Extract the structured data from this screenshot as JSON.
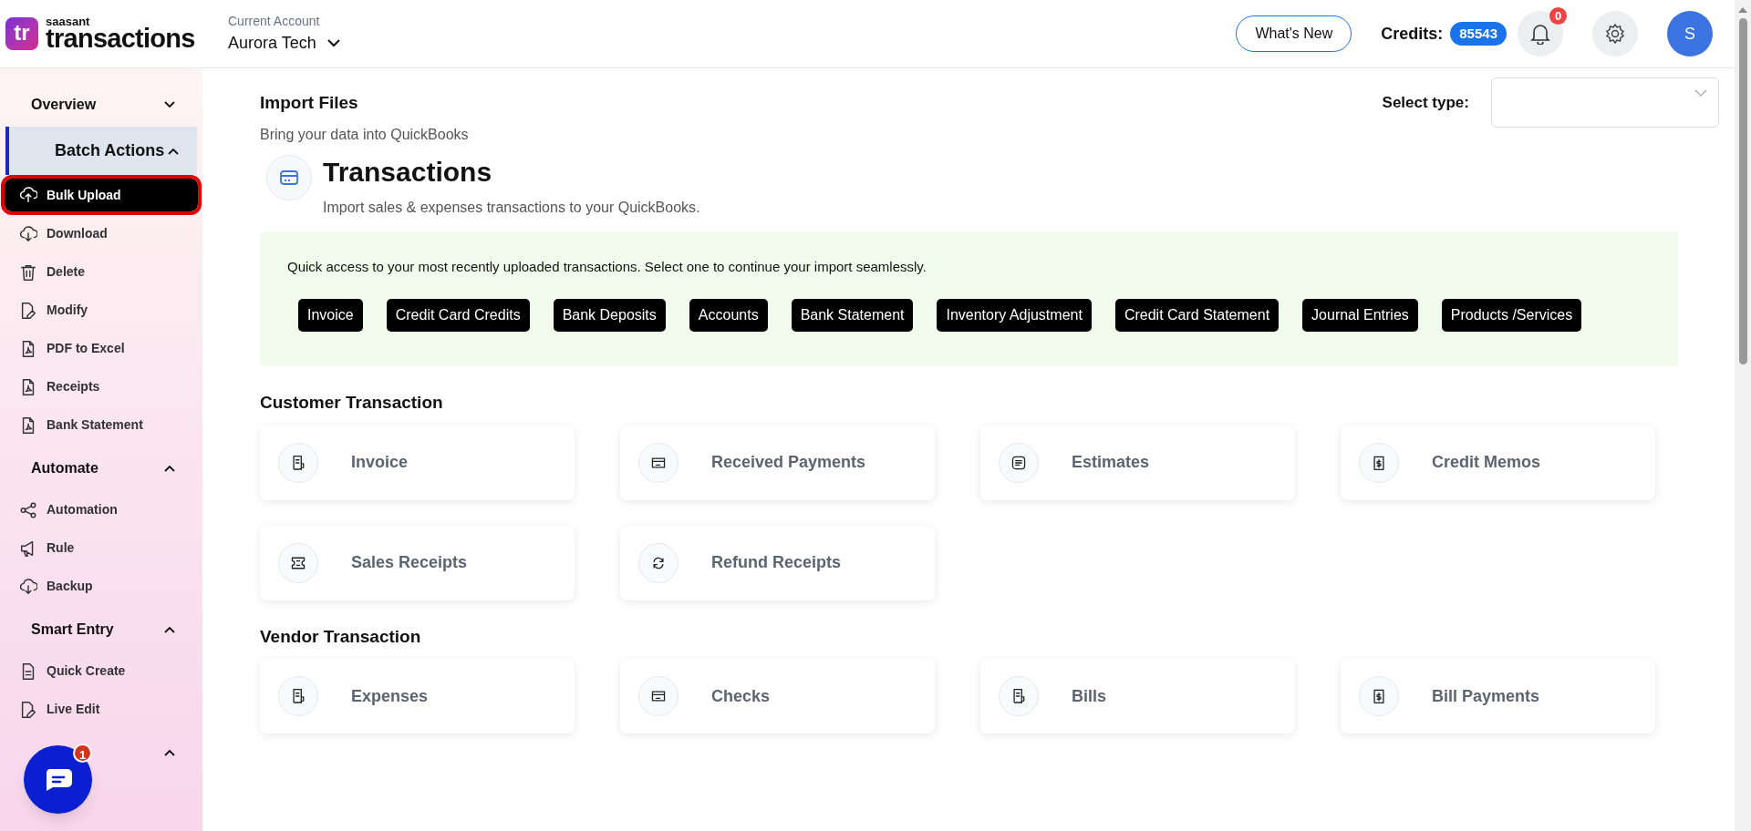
{
  "brand": {
    "logo": "tr",
    "small": "saasant",
    "large": "transactions"
  },
  "account": {
    "label": "Current Account",
    "name": "Aurora Tech"
  },
  "header": {
    "whats_new": "What's New",
    "credits_label": "Credits:",
    "credits": "85543",
    "notifications": "0",
    "avatar": "S"
  },
  "sidebar": {
    "sections": [
      {
        "title": "Overview",
        "expanded": false,
        "selected": false
      },
      {
        "title": "Batch Actions",
        "expanded": true,
        "selected": true,
        "items": [
          {
            "label": "Bulk Upload",
            "kind": "upload",
            "selected": true
          },
          {
            "label": "Download",
            "kind": "download",
            "selected": false
          },
          {
            "label": "Delete",
            "kind": "trash",
            "selected": false
          },
          {
            "label": "Modify",
            "kind": "edit",
            "selected": false
          },
          {
            "label": "PDF to Excel",
            "kind": "pdf",
            "selected": false
          },
          {
            "label": "Receipts",
            "kind": "pdf",
            "selected": false
          },
          {
            "label": "Bank Statement",
            "kind": "pdf",
            "selected": false
          }
        ]
      },
      {
        "title": "Automate",
        "expanded": true,
        "selected": false,
        "items": [
          {
            "label": "Automation",
            "kind": "share",
            "selected": false
          },
          {
            "label": "Rule",
            "kind": "megaphone",
            "selected": false
          },
          {
            "label": "Backup",
            "kind": "download",
            "selected": false
          }
        ]
      },
      {
        "title": "Smart Entry",
        "expanded": true,
        "selected": false,
        "items": [
          {
            "label": "Quick Create",
            "kind": "doc",
            "selected": false
          },
          {
            "label": "Live Edit",
            "kind": "edit",
            "selected": false
          }
        ]
      },
      {
        "expanded": true,
        "selected": false
      }
    ]
  },
  "chat": {
    "badge": "1"
  },
  "main": {
    "title": "Import Files",
    "select_label": "Select type:",
    "subtitle": "Bring your data into QuickBooks",
    "section": {
      "title": "Transactions",
      "description": "Import sales & expenses transactions to your QuickBooks."
    },
    "recent": {
      "text": "Quick access to your most recently uploaded transactions. Select one to continue your import seamlessly.",
      "chips": [
        "Invoice",
        "Credit Card Credits",
        "Bank Deposits",
        "Accounts",
        "Bank Statement",
        "Inventory Adjustment",
        "Credit Card Statement",
        "Journal Entries",
        "Products /Services"
      ]
    },
    "groups": [
      {
        "title": "Customer Transaction",
        "cards": [
          {
            "label": "Invoice",
            "kind": "receipt"
          },
          {
            "label": "Received Payments",
            "kind": "wallet"
          },
          {
            "label": "Estimates",
            "kind": "lines"
          },
          {
            "label": "Credit Memos",
            "kind": "dollar"
          },
          {
            "label": "Sales Receipts",
            "kind": "ticket"
          },
          {
            "label": "Refund Receipts",
            "kind": "refresh"
          }
        ]
      },
      {
        "title": "Vendor Transaction",
        "cards": [
          {
            "label": "Expenses",
            "kind": "receipt"
          },
          {
            "label": "Checks",
            "kind": "wallet"
          },
          {
            "label": "Bills",
            "kind": "receipt"
          },
          {
            "label": "Bill Payments",
            "kind": "dollar"
          }
        ]
      }
    ]
  }
}
